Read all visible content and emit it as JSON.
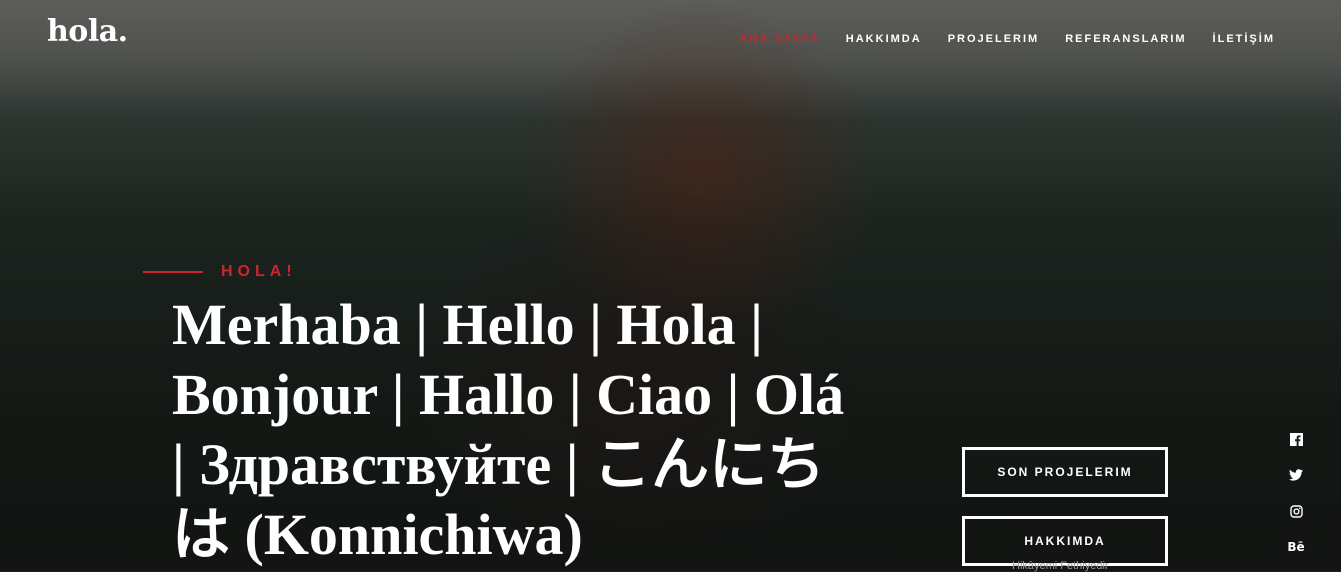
{
  "brand": {
    "logo": "hola."
  },
  "nav": {
    "items": [
      {
        "label": "ANA SAYFA",
        "active": true
      },
      {
        "label": "HAKKIMDA",
        "active": false
      },
      {
        "label": "PROJELERIM",
        "active": false
      },
      {
        "label": "REFERANSLARIM",
        "active": false
      },
      {
        "label": "İLETİŞİM",
        "active": false
      }
    ]
  },
  "hero": {
    "eyebrow": "HOLA!",
    "headline": "Merhaba | Hello | Hola | Bonjour | Hallo | Ciao | Olá | Здравствуйте | こんにちは (Konnichiwa)",
    "buttons": {
      "projects": "SON PROJELERIM",
      "about": "HAKKIMDA"
    }
  },
  "social": {
    "icons": [
      "facebook-icon",
      "twitter-icon",
      "instagram-icon",
      "behance-icon"
    ],
    "glyphs": {
      "facebook": "f",
      "twitter": "🐦",
      "instagram": "◎",
      "behance": "Bē"
    }
  },
  "footer": {
    "credit": "Hikâyemi Fethiyedir"
  },
  "colors": {
    "accent": "#c8272f",
    "text": "#ffffff"
  }
}
